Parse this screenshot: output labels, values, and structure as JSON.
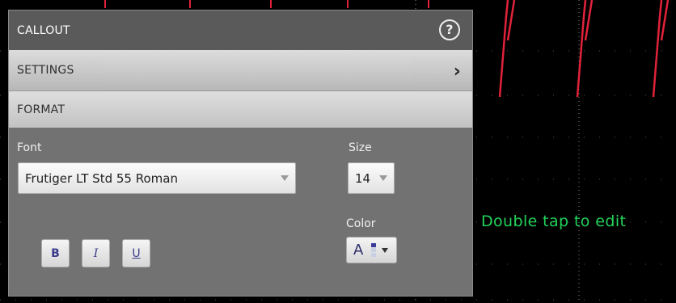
{
  "panel": {
    "title": "CALLOUT",
    "help_icon": "help-icon",
    "sections": {
      "settings": "SETTINGS",
      "format": "FORMAT"
    }
  },
  "format": {
    "font_label": "Font",
    "font_value": "Frutiger LT Std 55 Roman",
    "size_label": "Size",
    "size_value": "14",
    "color_label": "Color",
    "color_glyph": "A",
    "style_buttons": {
      "bold": "B",
      "italic": "I",
      "underline": "U"
    },
    "swatch_colors": [
      "#3a3a9a",
      "#c9d0e6",
      "#c9d0e6"
    ]
  },
  "scope": {
    "hint": "Double tap to edit",
    "hint_color": "#22d35a",
    "trace_color": "#e0223a",
    "grid_color": "#8a8a8a"
  },
  "colors": {
    "panel_bg": "#727272",
    "header_bg": "#5a5a5a",
    "button_text": "#3c3c8c"
  }
}
